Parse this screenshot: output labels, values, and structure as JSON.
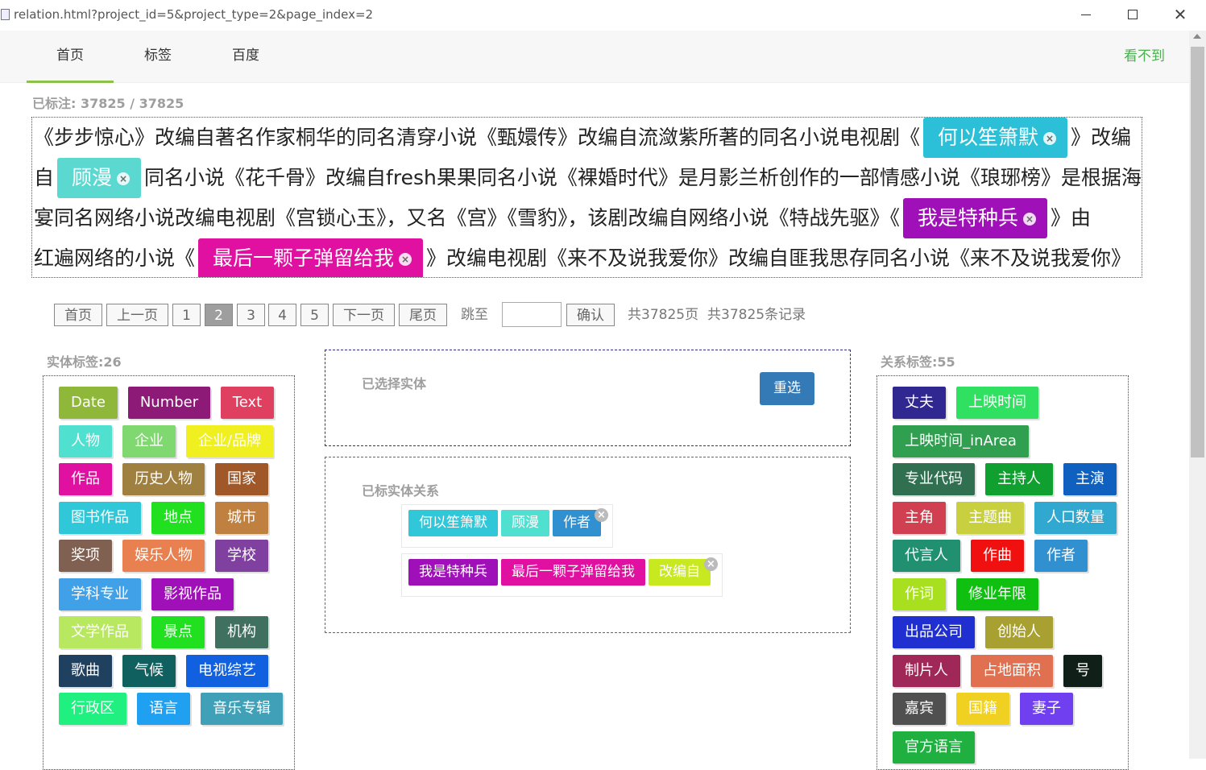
{
  "window": {
    "url": "relation.html?project_id=5&project_type=2&page_index=2",
    "min": "",
    "max": "",
    "close": "✕"
  },
  "nav": {
    "items": [
      "首页",
      "标签",
      "百度"
    ],
    "active": 0,
    "right": "看不到"
  },
  "counter": "已标注: 37825 / 37825",
  "text": {
    "lines": [
      [
        {
          "t": "《步步惊心》改编自著名作家桐华的同名清穿小说《甄嬛传》改编自流潋紫所著的同名小说电视剧《"
        },
        {
          "e": "何以笙箫默",
          "c": "#2bc0d8"
        },
        {
          "t": "》改编"
        }
      ],
      [
        {
          "t": "自"
        },
        {
          "e": "顾漫",
          "c": "#5bd8d0"
        },
        {
          "t": "同名小说《花千骨》改编自fresh果果同名小说《裸婚时代》是月影兰析创作的一部情感小说《琅琊榜》是根据海"
        }
      ],
      [
        {
          "t": "宴同名网络小说改编电视剧《宫锁心玉》，又名《宫》《雪豹》，该剧改编自网络小说《特战先驱》《"
        },
        {
          "e": "我是特种兵",
          "c": "#a010b8"
        },
        {
          "t": "》由"
        }
      ],
      [
        {
          "t": "红遍网络的小说《"
        },
        {
          "e": "最后一颗子弹留给我",
          "c": "#e010a0"
        },
        {
          "t": "》改编电视剧《来不及说我爱你》改编自匪我思存同名小说《来不及说我爱你》"
        }
      ]
    ]
  },
  "pager": {
    "buttons": [
      "首页",
      "上一页",
      "1",
      "2",
      "3",
      "4",
      "5",
      "下一页",
      "尾页"
    ],
    "current": "2",
    "jump_label": "跳至",
    "jump_value": "",
    "confirm": "确认",
    "total_pages": "共37825页",
    "total_records": "共37825条记录"
  },
  "entity_panel": {
    "title": "实体标签:26",
    "tags": [
      {
        "label": "Date",
        "color": "#8fb83a"
      },
      {
        "label": "Number",
        "color": "#8e1a78"
      },
      {
        "label": "Text",
        "color": "#e04060"
      },
      {
        "label": "人物",
        "color": "#50e0d0"
      },
      {
        "label": "企业",
        "color": "#80d870"
      },
      {
        "label": "企业/品牌",
        "color": "#f0f020"
      },
      {
        "label": "作品",
        "color": "#e010a0"
      },
      {
        "label": "历史人物",
        "color": "#a08040"
      },
      {
        "label": "国家",
        "color": "#a05828"
      },
      {
        "label": "图书作品",
        "color": "#30c8d8"
      },
      {
        "label": "地点",
        "color": "#20e020"
      },
      {
        "label": "城市",
        "color": "#c08040"
      },
      {
        "label": "奖项",
        "color": "#806050"
      },
      {
        "label": "娱乐人物",
        "color": "#e88050"
      },
      {
        "label": "学校",
        "color": "#8040a0"
      },
      {
        "label": "学科专业",
        "color": "#40a0e8"
      },
      {
        "label": "影视作品",
        "color": "#a010b8"
      },
      {
        "label": "文学作品",
        "color": "#b8e860"
      },
      {
        "label": "景点",
        "color": "#20e020"
      },
      {
        "label": "机构",
        "color": "#407060"
      },
      {
        "label": "歌曲",
        "color": "#204060"
      },
      {
        "label": "气候",
        "color": "#106060"
      },
      {
        "label": "电视综艺",
        "color": "#1060e0"
      },
      {
        "label": "行政区",
        "color": "#20f080"
      },
      {
        "label": "语言",
        "color": "#20a0f0"
      },
      {
        "label": "音乐专辑",
        "color": "#40a0b8"
      }
    ]
  },
  "selected_box": {
    "title": "已选择实体",
    "reselect": "重选"
  },
  "relations_box": {
    "title": "已标实体关系",
    "groups": [
      [
        {
          "label": "何以笙箫默",
          "color": "#30c8d8"
        },
        {
          "label": "顾漫",
          "color": "#50e0d0"
        },
        {
          "label": "作者",
          "color": "#3090d0"
        }
      ],
      [
        {
          "label": "我是特种兵",
          "color": "#a010b8"
        },
        {
          "label": "最后一颗子弹留给我",
          "color": "#e010a0"
        },
        {
          "label": "改编自",
          "color": "#c8e820"
        }
      ]
    ]
  },
  "relation_panel": {
    "title": "关系标签:55",
    "tags": [
      {
        "label": "丈夫",
        "color": "#302890"
      },
      {
        "label": "上映时间",
        "color": "#30e060"
      },
      {
        "label": "上映时间_inArea",
        "color": "#30a050"
      },
      {
        "label": "专业代码",
        "color": "#307050"
      },
      {
        "label": "主持人",
        "color": "#10a030"
      },
      {
        "label": "主演",
        "color": "#1060c0"
      },
      {
        "label": "主角",
        "color": "#d04050"
      },
      {
        "label": "主题曲",
        "color": "#c8d040"
      },
      {
        "label": "人口数量",
        "color": "#30a8d0"
      },
      {
        "label": "代言人",
        "color": "#209070"
      },
      {
        "label": "作曲",
        "color": "#f01010"
      },
      {
        "label": "作者",
        "color": "#3090d0"
      },
      {
        "label": "作词",
        "color": "#a8e020"
      },
      {
        "label": "修业年限",
        "color": "#10c010"
      },
      {
        "label": "出品公司",
        "color": "#2030d0"
      },
      {
        "label": "创始人",
        "color": "#a8a030"
      },
      {
        "label": "制片人",
        "color": "#a02858"
      },
      {
        "label": "占地面积",
        "color": "#e07050"
      },
      {
        "label": "号",
        "color": "#102018"
      },
      {
        "label": "嘉宾",
        "color": "#505050"
      },
      {
        "label": "国籍",
        "color": "#f0d020"
      },
      {
        "label": "妻子",
        "color": "#7040f0"
      },
      {
        "label": "官方语言",
        "color": "#20b040"
      }
    ]
  }
}
